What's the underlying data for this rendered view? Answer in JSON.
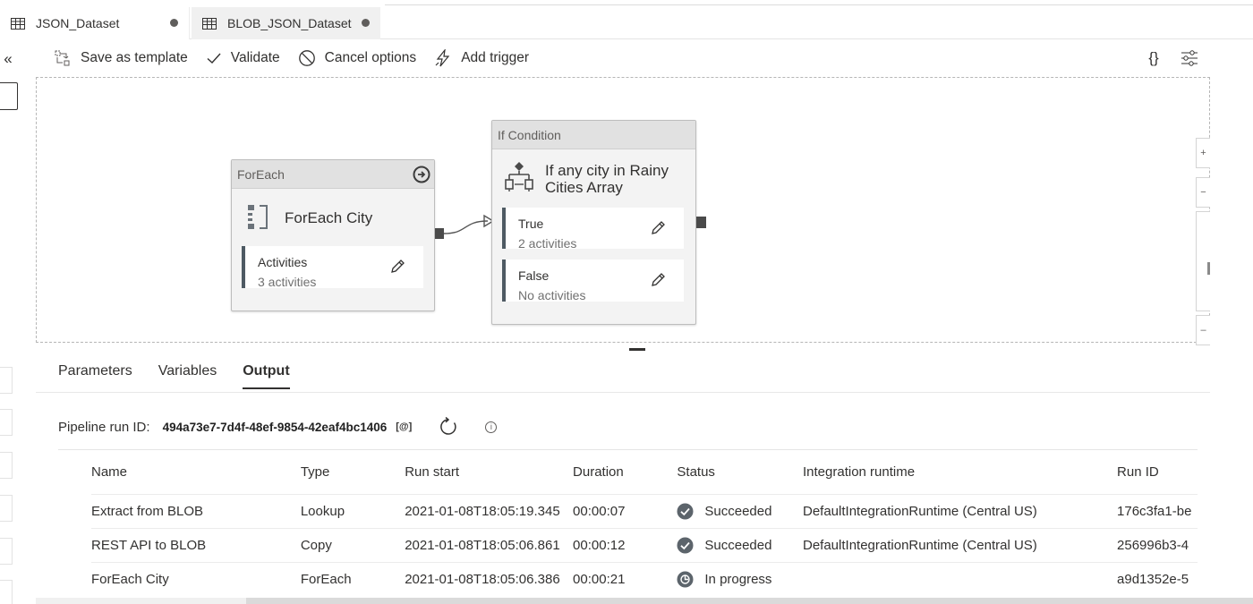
{
  "tabs": [
    {
      "label": "JSON_Dataset",
      "icon": "table-icon",
      "unsaved": true
    },
    {
      "label": "BLOB_JSON_Dataset",
      "icon": "table-icon",
      "unsaved": true
    }
  ],
  "left_rail": {
    "collapse_label": "«"
  },
  "toolbar": {
    "save_template": "Save as template",
    "validate": "Validate",
    "cancel_options": "Cancel options",
    "add_trigger": "Add trigger",
    "code_label": "{}"
  },
  "canvas": {
    "foreach": {
      "type": "ForEach",
      "name": "ForEach City",
      "activities_label": "Activities",
      "activities_count": "3 activities"
    },
    "ifcondition": {
      "type": "If Condition",
      "name_line1": "If any city in Rainy",
      "name_line2": "Cities Array",
      "true_label": "True",
      "true_count": "2 activities",
      "false_label": "False",
      "false_count": "No activities"
    }
  },
  "bottom": {
    "tabs": [
      "Parameters",
      "Variables",
      "Output"
    ],
    "active_tab": "Output",
    "pipeline_run_label": "Pipeline run ID:",
    "pipeline_run_id": "494a73e7-7d4f-48ef-9854-42eaf4bc1406",
    "copy_label": "[@]",
    "columns": [
      "Name",
      "Type",
      "Run start",
      "Duration",
      "Status",
      "Integration runtime",
      "Run ID"
    ],
    "rows": [
      {
        "name": "Extract from BLOB",
        "type": "Lookup",
        "run_start": "2021-01-08T18:05:19.345",
        "duration": "00:00:07",
        "status": "Succeeded",
        "status_icon": "check-circle-icon",
        "runtime": "DefaultIntegrationRuntime (Central US)",
        "run_id": "176c3fa1-be"
      },
      {
        "name": "REST API to BLOB",
        "type": "Copy",
        "run_start": "2021-01-08T18:05:06.861",
        "duration": "00:00:12",
        "status": "Succeeded",
        "status_icon": "check-circle-icon",
        "runtime": "DefaultIntegrationRuntime (Central US)",
        "run_id": "256996b3-4"
      },
      {
        "name": "ForEach City",
        "type": "ForEach",
        "run_start": "2021-01-08T18:05:06.386",
        "duration": "00:00:21",
        "status": "In progress",
        "status_icon": "in-progress-icon",
        "runtime": "",
        "run_id": "a9d1352e-5"
      }
    ]
  },
  "colors": {
    "accent_bar": "#4e5a63",
    "status_icon": "#5c646b",
    "header_bg": "#e1e1e1"
  }
}
